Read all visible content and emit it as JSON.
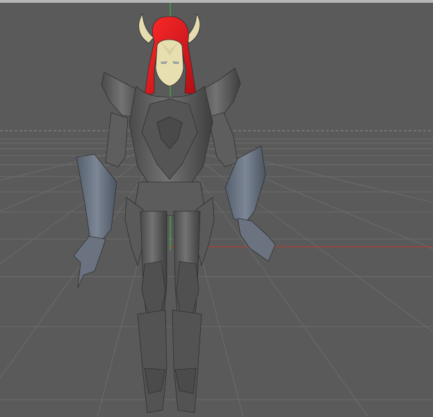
{
  "viewport": {
    "view": "perspective",
    "background_color": "#5a5a5a",
    "top_border_color": "#b8b8b8",
    "grid": {
      "visible": true,
      "line_color": "#6a6a6a",
      "horizon_dashed": true
    },
    "axes": {
      "x_axis_color": "#c0392b",
      "y_axis_color": "#2ecc40"
    }
  },
  "model": {
    "type": "armored warrior character",
    "armor_color": "#666666",
    "gauntlet_color": "#6b7280",
    "hair_color": "#e0151c",
    "skin_color": "#e8dfb0",
    "horn_color": "#e5dcb0"
  }
}
